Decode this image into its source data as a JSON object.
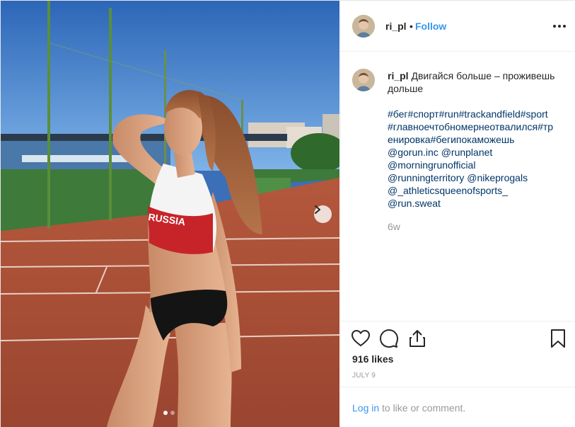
{
  "post": {
    "username": "ri_pl",
    "separator": "•",
    "follow_label": "Follow",
    "more_icon": "more-horizontal-icon",
    "caption_text": "Двигайся больше – проживешь дольше",
    "hashtag_lines": [
      "#бег#спорт#run#trackandfield#sport",
      "#главноечтобномернеотвалился#тр",
      "енировка#бегипокаможешь",
      "@gorun.inc @runplanet",
      "@morningrunofficial",
      "@runningterritory @nikeprogals",
      "@_athleticsqueenofsports_",
      "@run.sweat"
    ],
    "comment_time": "6w",
    "likes": "916 likes",
    "date": "JULY 9",
    "login_link": "Log in",
    "login_rest": "to like or comment.",
    "icons": {
      "like": "heart-icon",
      "comment": "comment-icon",
      "share": "share-icon",
      "save": "bookmark-icon",
      "next": "chevron-right-icon"
    },
    "image_description_shirt_text": "RUSSIA",
    "carousel": {
      "slides": 2,
      "current": 1
    },
    "colors": {
      "link": "#3897f0",
      "hashtag": "#003569",
      "muted": "#999999"
    }
  }
}
